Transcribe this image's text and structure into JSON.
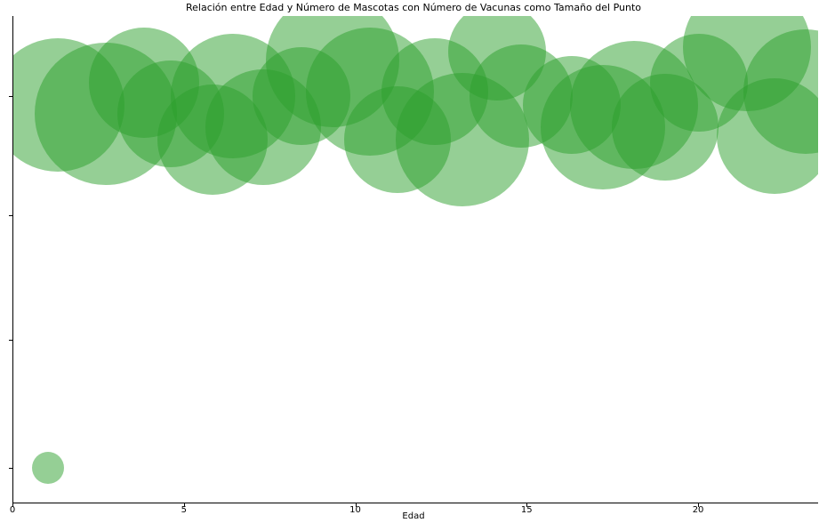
{
  "chart_data": {
    "type": "scatter",
    "title": "Relación entre Edad y Número de Mascotas con Número de Vacunas como Tamaño del Punto",
    "xlabel": "Edad",
    "ylabel": "",
    "xlim": [
      0,
      23.5
    ],
    "ylim": [
      0,
      1.1
    ],
    "x_ticks": [
      0,
      5,
      10,
      15,
      20
    ],
    "y_tick_positions": [
      0.08,
      0.37,
      0.65,
      0.92
    ],
    "color": "#2ca02c",
    "alpha": 0.5,
    "size_note": "Bubble radius encodes Número de Vacunas (larger = more vaccines)",
    "points": [
      {
        "x": 1.0,
        "y": 0.08,
        "r": 18
      },
      {
        "x": 1.3,
        "y": 0.9,
        "r": 75
      },
      {
        "x": 2.7,
        "y": 0.88,
        "r": 80
      },
      {
        "x": 3.8,
        "y": 0.95,
        "r": 62
      },
      {
        "x": 4.6,
        "y": 0.88,
        "r": 60
      },
      {
        "x": 5.8,
        "y": 0.82,
        "r": 62
      },
      {
        "x": 6.4,
        "y": 0.92,
        "r": 70
      },
      {
        "x": 7.3,
        "y": 0.85,
        "r": 65
      },
      {
        "x": 8.4,
        "y": 0.92,
        "r": 55
      },
      {
        "x": 9.3,
        "y": 1.0,
        "r": 75
      },
      {
        "x": 10.4,
        "y": 0.93,
        "r": 72
      },
      {
        "x": 11.2,
        "y": 0.82,
        "r": 60
      },
      {
        "x": 12.3,
        "y": 0.93,
        "r": 60
      },
      {
        "x": 13.1,
        "y": 0.82,
        "r": 75
      },
      {
        "x": 14.1,
        "y": 1.02,
        "r": 55
      },
      {
        "x": 14.8,
        "y": 0.92,
        "r": 58
      },
      {
        "x": 16.3,
        "y": 0.9,
        "r": 55
      },
      {
        "x": 17.2,
        "y": 0.85,
        "r": 70
      },
      {
        "x": 18.1,
        "y": 0.9,
        "r": 72
      },
      {
        "x": 19.0,
        "y": 0.85,
        "r": 60
      },
      {
        "x": 20.0,
        "y": 0.95,
        "r": 55
      },
      {
        "x": 21.4,
        "y": 1.03,
        "r": 72
      },
      {
        "x": 22.2,
        "y": 0.83,
        "r": 65
      },
      {
        "x": 23.1,
        "y": 0.93,
        "r": 70
      }
    ]
  }
}
